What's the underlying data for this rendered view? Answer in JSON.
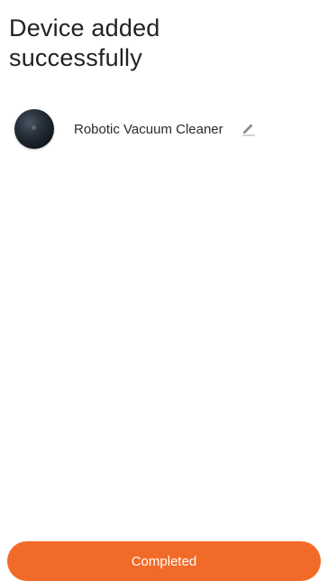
{
  "header": {
    "title": "Device added successfully"
  },
  "device": {
    "name": "Robotic Vacuum Cleaner",
    "icon": "robot-vacuum-icon",
    "edit_icon": "pencil-icon"
  },
  "footer": {
    "button_label": "Completed",
    "button_color": "#f26a28"
  }
}
